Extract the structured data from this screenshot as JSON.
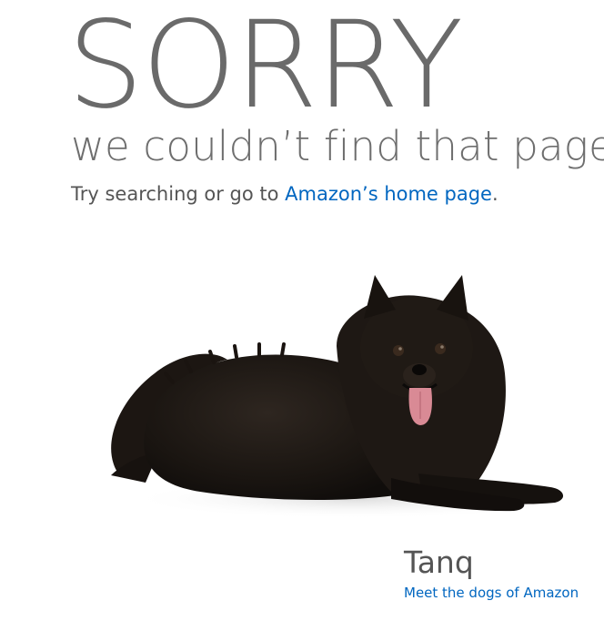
{
  "headline": "SORRY",
  "subtitle": "we couldn’t find that page",
  "hint": {
    "prefix": "Try searching or go to ",
    "link_label": "Amazon’s home page",
    "suffix": "."
  },
  "dog": {
    "name": "Tanq",
    "link_label": "Meet the dogs of Amazon",
    "image_icon": "black-pomeranian-dog-photo"
  },
  "colors": {
    "text": "#555555",
    "headline": "#6a6a6a",
    "link": "#0066c0",
    "background": "#ffffff"
  }
}
